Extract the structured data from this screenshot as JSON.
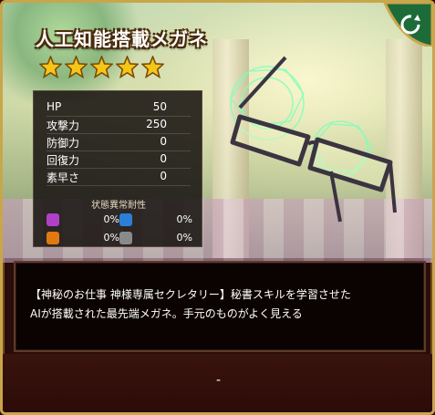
{
  "item": {
    "name": "人工知能搭載メガネ",
    "rarity_stars": 5
  },
  "stats": [
    {
      "label": "HP",
      "value": "50"
    },
    {
      "label": "攻撃力",
      "value": "250"
    },
    {
      "label": "防御力",
      "value": "0"
    },
    {
      "label": "回復力",
      "value": "0"
    },
    {
      "label": "素早さ",
      "value": "0"
    }
  ],
  "status_resist": {
    "title": "状態異常耐性",
    "items": [
      {
        "icon": "poison-icon",
        "color": "#b040c8",
        "value": "0%"
      },
      {
        "icon": "sleep-icon",
        "color": "#2a80d8",
        "value": "0%"
      },
      {
        "icon": "paralysis-icon",
        "color": "#e07a10",
        "value": "0%"
      },
      {
        "icon": "seal-icon",
        "color": "#8a8a8a",
        "value": "0%"
      }
    ]
  },
  "description": {
    "line1": "【神秘のお仕事 神様専属セクレタリー】秘書スキルを学習させた",
    "line2": "AIが搭載された最先端メガネ。手元のものがよく見える"
  },
  "footer": {
    "text": "-"
  },
  "colors": {
    "star": "#f5c518",
    "frame_gold": "#c9a64a",
    "corner_green": "#1e6b3a"
  }
}
